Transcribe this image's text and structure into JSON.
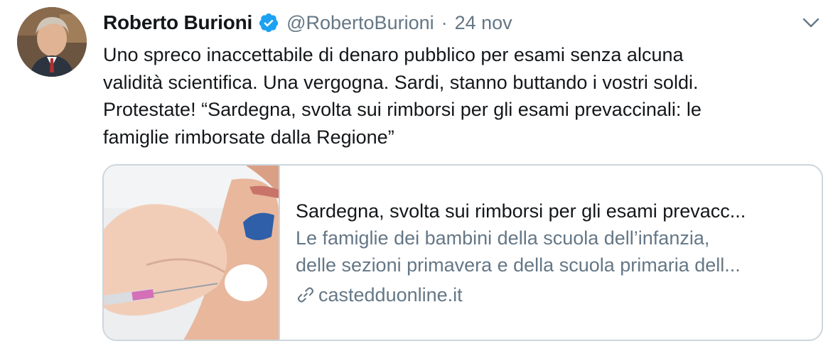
{
  "author": {
    "name": "Roberto Burioni",
    "handle": "@RobertoBurioni",
    "separator": "·",
    "date": "24 nov"
  },
  "tweet": {
    "lines": [
      "Uno spreco inaccettabile di denaro pubblico per esami senza alcuna",
      "validità scientifica. Una vergogna. Sardi, stanno buttando i vostri soldi.",
      "Protestate! “Sardegna, svolta sui rimborsi per gli esami prevaccinali: le",
      "famiglie rimborsate dalla Regione”"
    ]
  },
  "card": {
    "title": "Sardegna, svolta sui rimborsi per gli esami prevacc...",
    "description_lines": [
      "Le famiglie dei bambini della scuola dell’infanzia,",
      "delle sezioni primavera e della scuola primaria dell..."
    ],
    "domain": "castedduonline.it"
  },
  "icons": {
    "verified": "verified-badge-icon",
    "caret": "chevron-down-icon",
    "link": "link-icon"
  },
  "colors": {
    "text": "#14171a",
    "secondary": "#657786",
    "verified": "#1da1f2",
    "border": "#ccd6dd"
  }
}
